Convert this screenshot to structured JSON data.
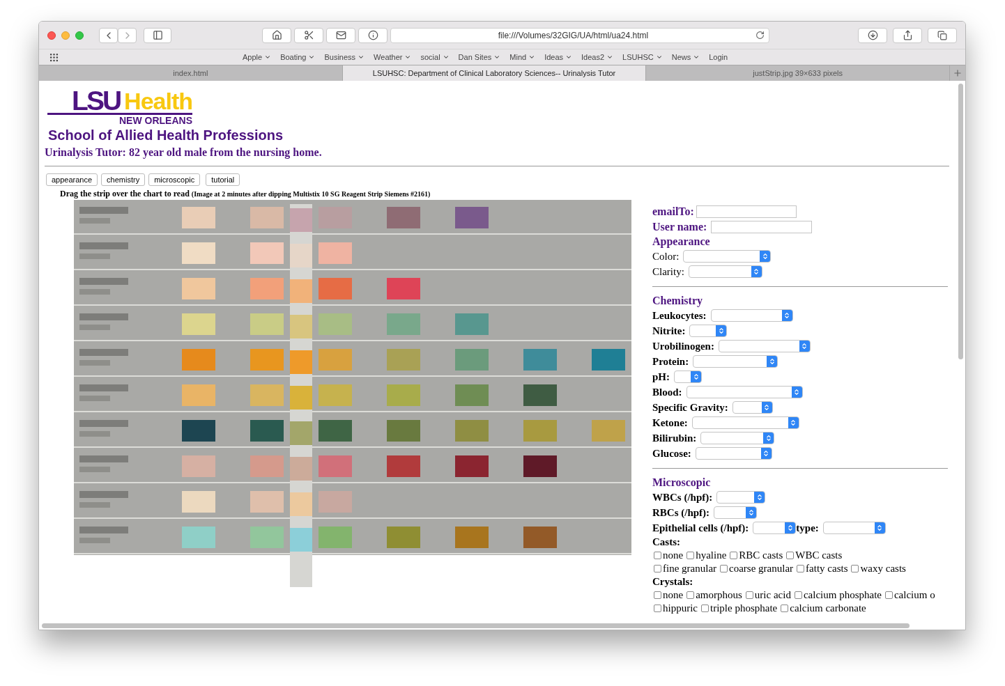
{
  "browser": {
    "url": "file:///Volumes/32GIG/UA/html/ua24.html",
    "bookmarks": [
      {
        "label": "Apple",
        "menu": true
      },
      {
        "label": "Boating",
        "menu": true
      },
      {
        "label": "Business",
        "menu": true
      },
      {
        "label": "Weather",
        "menu": true
      },
      {
        "label": "social",
        "menu": true
      },
      {
        "label": "Dan Sites",
        "menu": true
      },
      {
        "label": "Mind",
        "menu": true
      },
      {
        "label": "Ideas",
        "menu": true
      },
      {
        "label": "Ideas2",
        "menu": true
      },
      {
        "label": "LSUHSC",
        "menu": true
      },
      {
        "label": "News",
        "menu": true
      },
      {
        "label": "Login",
        "menu": false
      }
    ],
    "tabs": [
      {
        "label": "index.html",
        "selected": false
      },
      {
        "label": "LSUHSC: Department of Clinical Laboratory Sciences-- Urinalysis Tutor",
        "selected": true
      },
      {
        "label": "justStrip.jpg 39×633 pixels",
        "selected": false
      }
    ]
  },
  "page": {
    "logo": {
      "primary": "LSU",
      "secondary": "Health",
      "tagline": "NEW ORLEANS"
    },
    "school": "School of Allied Health Professions",
    "title": "Urinalysis Tutor: 82 year old male from the nursing home.",
    "nav_buttons": [
      "appearance",
      "chemistry",
      "microscopic",
      "tutorial"
    ],
    "instruction": "Drag the strip over the chart to read",
    "instruction_note": "(Image at 2 minutes after dipping Multistix 10 SG Reagent Strip Siemens #2161)",
    "form": {
      "email_label": "emailTo:",
      "username_label": "User name:",
      "sections": [
        {
          "kind": "appearance",
          "heading": "Appearance",
          "items": [
            {
              "kind": "select",
              "label": "Color:"
            },
            {
              "kind": "select",
              "label": "Clarity:"
            }
          ]
        },
        {
          "kind": "chemistry",
          "heading": "Chemistry",
          "items": [
            {
              "kind": "select",
              "label": "Leukocytes:"
            },
            {
              "kind": "select",
              "label": "Nitrite:"
            },
            {
              "kind": "select",
              "label": "Urobilinogen:"
            },
            {
              "kind": "select",
              "label": "Protein:"
            },
            {
              "kind": "select",
              "label": "pH:"
            },
            {
              "kind": "select",
              "label": "Blood:"
            },
            {
              "kind": "select",
              "label": "Specific Gravity:"
            },
            {
              "kind": "select",
              "label": "Ketone:"
            },
            {
              "kind": "select",
              "label": "Bilirubin:"
            },
            {
              "kind": "select",
              "label": "Glucose:"
            }
          ]
        },
        {
          "kind": "microscopic",
          "heading": "Microscopic",
          "items": [
            {
              "kind": "select",
              "label": "WBCs (/hpf):"
            },
            {
              "kind": "select",
              "label": "RBCs (/hpf):"
            },
            {
              "kind": "select_pair",
              "label": "Epithelial cells (/hpf):",
              "second_label": "type:"
            },
            {
              "kind": "heading",
              "label": "Casts:"
            },
            {
              "kind": "checkbox_line",
              "options": [
                {
                  "label": "none",
                  "checked": false
                },
                {
                  "label": "hyaline",
                  "checked": false
                },
                {
                  "label": "RBC casts",
                  "checked": false
                },
                {
                  "label": "WBC casts",
                  "checked": false
                }
              ]
            },
            {
              "kind": "checkbox_line",
              "options": [
                {
                  "label": "fine granular",
                  "checked": false
                },
                {
                  "label": "coarse granular",
                  "checked": false
                },
                {
                  "label": "fatty casts",
                  "checked": false
                },
                {
                  "label": "waxy casts",
                  "checked": false
                }
              ]
            },
            {
              "kind": "heading",
              "label": "Crystals:"
            },
            {
              "kind": "checkbox_line",
              "options": [
                {
                  "label": "none",
                  "checked": false
                },
                {
                  "label": "amorphous",
                  "checked": false
                },
                {
                  "label": "uric acid",
                  "checked": false
                },
                {
                  "label": "calcium phosphate",
                  "checked": false
                },
                {
                  "label": "calcium o",
                  "checked": false
                }
              ]
            },
            {
              "kind": "checkbox_line",
              "options": [
                {
                  "label": "hippuric",
                  "checked": false
                },
                {
                  "label": "triple phosphate",
                  "checked": false
                },
                {
                  "label": "calcium carbonate",
                  "checked": false
                }
              ]
            }
          ]
        }
      ]
    }
  }
}
